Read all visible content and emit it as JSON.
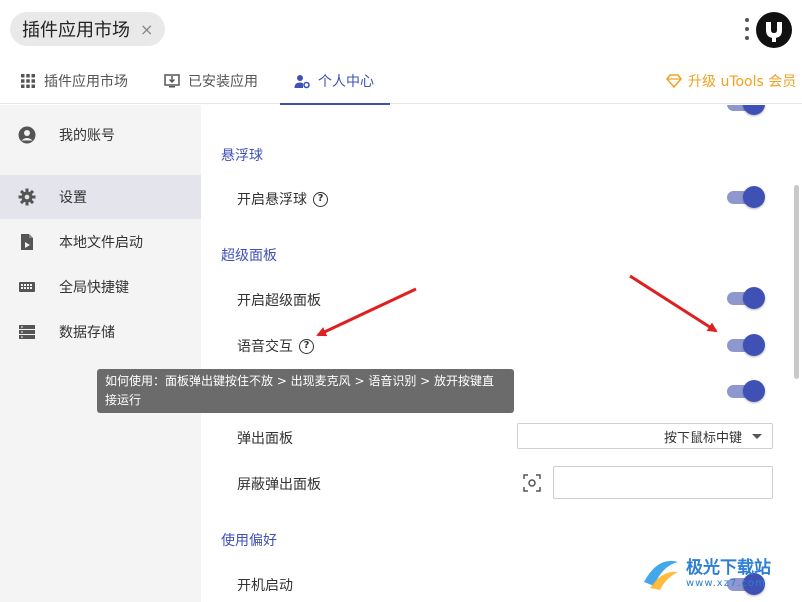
{
  "titlebar": {
    "app_tab_label": "插件应用市场",
    "close_glyph": "×"
  },
  "nav": {
    "tabs": [
      {
        "label": "插件应用市场",
        "icon": "grid-icon"
      },
      {
        "label": "已安装应用",
        "icon": "download-monitor-icon"
      },
      {
        "label": "个人中心",
        "icon": "user-settings-icon"
      }
    ],
    "upgrade_label": "升级 uTools 会员",
    "accent_color": "#3f51b5",
    "upgrade_color": "#f0a020"
  },
  "sidebar": {
    "items": [
      {
        "label": "我的账号",
        "icon": "account-circle-icon"
      },
      {
        "label": "设置",
        "icon": "gear-icon"
      },
      {
        "label": "本地文件启动",
        "icon": "file-launch-icon"
      },
      {
        "label": "全局快捷键",
        "icon": "keyboard-icon"
      },
      {
        "label": "数据存储",
        "icon": "storage-icon"
      }
    ]
  },
  "content": {
    "sections": {
      "floating_ball": {
        "title": "悬浮球",
        "enable_label": "开启悬浮球"
      },
      "super_panel": {
        "title": "超级面板",
        "enable_label": "开启超级面板",
        "voice_label": "语音交互",
        "popup_label": "弹出面板",
        "popup_value": "按下鼠标中键",
        "block_label": "屏蔽弹出面板"
      },
      "preferences": {
        "title": "使用偏好",
        "autostart_label": "开机启动"
      }
    },
    "tooltip_text": "如何使用：面板弹出键按住不放 > 出现麦克风 > 语音识别 > 放开按键直接运行"
  },
  "watermark": {
    "text": "极光下载站",
    "sub": "www.xz7.com"
  }
}
